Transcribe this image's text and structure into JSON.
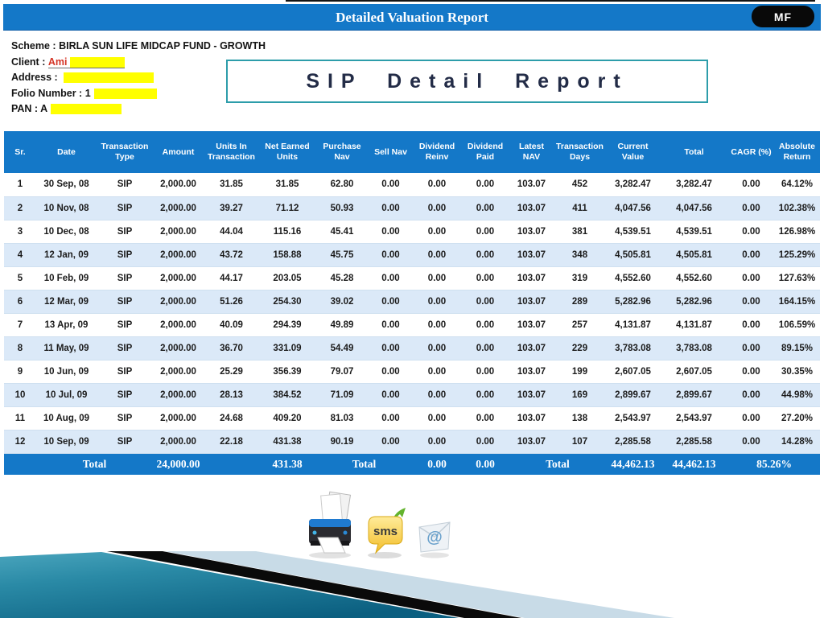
{
  "header": {
    "title": "Detailed Valuation Report",
    "badge": "MF"
  },
  "info": {
    "scheme_label": "Scheme :",
    "scheme_value": "BIRLA SUN LIFE MIDCAP FUND - GROWTH",
    "client_label": "Client :",
    "client_value": "Ami",
    "address_label": "Address :",
    "folio_label": "Folio Number :",
    "folio_value": "1",
    "pan_label": "PAN :",
    "pan_value": "A"
  },
  "report_box": {
    "title": "SIP Detail Report"
  },
  "table": {
    "columns": [
      "Sr.",
      "Date",
      "Transaction Type",
      "Amount",
      "Units In Transaction",
      "Net Earned Units",
      "Purchase Nav",
      "Sell Nav",
      "Dividend Reinv",
      "Dividend Paid",
      "Latest NAV",
      "Transaction Days",
      "Current Value",
      "Total",
      "CAGR (%)",
      "Absolute Return"
    ],
    "rows": [
      [
        "1",
        "30 Sep, 08",
        "SIP",
        "2,000.00",
        "31.85",
        "31.85",
        "62.80",
        "0.00",
        "0.00",
        "0.00",
        "103.07",
        "452",
        "3,282.47",
        "3,282.47",
        "0.00",
        "64.12%"
      ],
      [
        "2",
        "10 Nov, 08",
        "SIP",
        "2,000.00",
        "39.27",
        "71.12",
        "50.93",
        "0.00",
        "0.00",
        "0.00",
        "103.07",
        "411",
        "4,047.56",
        "4,047.56",
        "0.00",
        "102.38%"
      ],
      [
        "3",
        "10 Dec, 08",
        "SIP",
        "2,000.00",
        "44.04",
        "115.16",
        "45.41",
        "0.00",
        "0.00",
        "0.00",
        "103.07",
        "381",
        "4,539.51",
        "4,539.51",
        "0.00",
        "126.98%"
      ],
      [
        "4",
        "12 Jan, 09",
        "SIP",
        "2,000.00",
        "43.72",
        "158.88",
        "45.75",
        "0.00",
        "0.00",
        "0.00",
        "103.07",
        "348",
        "4,505.81",
        "4,505.81",
        "0.00",
        "125.29%"
      ],
      [
        "5",
        "10 Feb, 09",
        "SIP",
        "2,000.00",
        "44.17",
        "203.05",
        "45.28",
        "0.00",
        "0.00",
        "0.00",
        "103.07",
        "319",
        "4,552.60",
        "4,552.60",
        "0.00",
        "127.63%"
      ],
      [
        "6",
        "12 Mar, 09",
        "SIP",
        "2,000.00",
        "51.26",
        "254.30",
        "39.02",
        "0.00",
        "0.00",
        "0.00",
        "103.07",
        "289",
        "5,282.96",
        "5,282.96",
        "0.00",
        "164.15%"
      ],
      [
        "7",
        "13 Apr, 09",
        "SIP",
        "2,000.00",
        "40.09",
        "294.39",
        "49.89",
        "0.00",
        "0.00",
        "0.00",
        "103.07",
        "257",
        "4,131.87",
        "4,131.87",
        "0.00",
        "106.59%"
      ],
      [
        "8",
        "11 May, 09",
        "SIP",
        "2,000.00",
        "36.70",
        "331.09",
        "54.49",
        "0.00",
        "0.00",
        "0.00",
        "103.07",
        "229",
        "3,783.08",
        "3,783.08",
        "0.00",
        "89.15%"
      ],
      [
        "9",
        "10 Jun, 09",
        "SIP",
        "2,000.00",
        "25.29",
        "356.39",
        "79.07",
        "0.00",
        "0.00",
        "0.00",
        "103.07",
        "199",
        "2,607.05",
        "2,607.05",
        "0.00",
        "30.35%"
      ],
      [
        "10",
        "10 Jul, 09",
        "SIP",
        "2,000.00",
        "28.13",
        "384.52",
        "71.09",
        "0.00",
        "0.00",
        "0.00",
        "103.07",
        "169",
        "2,899.67",
        "2,899.67",
        "0.00",
        "44.98%"
      ],
      [
        "11",
        "10 Aug, 09",
        "SIP",
        "2,000.00",
        "24.68",
        "409.20",
        "81.03",
        "0.00",
        "0.00",
        "0.00",
        "103.07",
        "138",
        "2,543.97",
        "2,543.97",
        "0.00",
        "27.20%"
      ],
      [
        "12",
        "10 Sep, 09",
        "SIP",
        "2,000.00",
        "22.18",
        "431.38",
        "90.19",
        "0.00",
        "0.00",
        "0.00",
        "103.07",
        "107",
        "2,285.58",
        "2,285.58",
        "0.00",
        "14.28%"
      ]
    ],
    "total_row": {
      "label1": "Total",
      "amount": "24,000.00",
      "net_earned_units": "431.38",
      "label2": "Total",
      "dividend_reinv": "0.00",
      "dividend_paid": "0.00",
      "label3": "Total",
      "current_value": "44,462.13",
      "total": "44,462.13",
      "absolute_return": "85.26%"
    }
  },
  "actions": {
    "sms_label": "sms",
    "email_symbol": "@"
  },
  "colors": {
    "header_blue": "#1478c8",
    "alt_row_blue": "#dbe9f8",
    "box_teal": "#2d9daa",
    "redaction_yellow": "#ffff00",
    "badge_black": "#090909",
    "client_red": "#d43425",
    "stripe_teal_dark": "#0b5f80",
    "stripe_teal_light": "#4aa5bd",
    "stripe_black": "#0a0a0a",
    "stripe_light_blue": "#c8dbe7"
  }
}
